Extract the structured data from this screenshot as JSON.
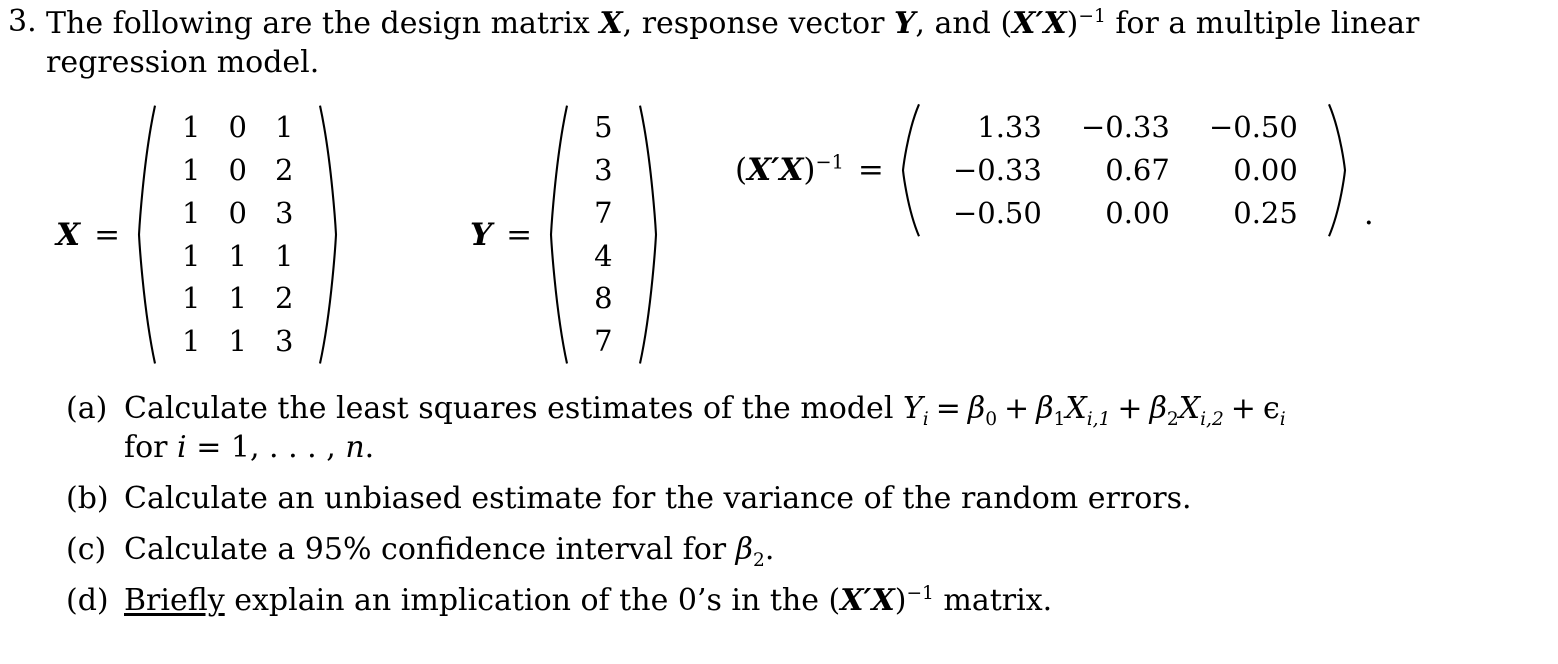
{
  "problem": {
    "number": "3.",
    "intro_part1": "The following are the design matrix ",
    "var_X": "X",
    "intro_part2": ", response vector ",
    "var_Y": "Y",
    "intro_part3": ", and ",
    "xtx_open": "(",
    "xtx_X1": "X",
    "xtx_prime": "′",
    "xtx_X2": "X",
    "xtx_close": ")",
    "xtx_exp": "−1",
    "intro_part4": " for a multiple linear regression model."
  },
  "matrices": {
    "X": {
      "label": "X",
      "equals": "=",
      "rows": [
        [
          "1",
          "0",
          "1"
        ],
        [
          "1",
          "0",
          "2"
        ],
        [
          "1",
          "0",
          "3"
        ],
        [
          "1",
          "1",
          "1"
        ],
        [
          "1",
          "1",
          "2"
        ],
        [
          "1",
          "1",
          "3"
        ]
      ]
    },
    "Y": {
      "label": "Y",
      "equals": "=",
      "rows": [
        [
          "5"
        ],
        [
          "3"
        ],
        [
          "7"
        ],
        [
          "4"
        ],
        [
          "8"
        ],
        [
          "7"
        ]
      ]
    },
    "XtX_inv": {
      "label_open": "(",
      "label_X1": "X",
      "label_prime": "′",
      "label_X2": "X",
      "label_close": ")",
      "label_exp": "−1",
      "equals": "=",
      "rows": [
        [
          "1.33",
          "−0.33",
          "−0.50"
        ],
        [
          "−0.33",
          "0.67",
          "0.00"
        ],
        [
          "−0.50",
          "0.00",
          "0.25"
        ]
      ],
      "trailing_period": "."
    }
  },
  "subparts": [
    {
      "label": "(a)",
      "text_pre": "Calculate the least squares estimates of the model ",
      "eq_Y": "Y",
      "eq_Y_sub": "i",
      "eq_equals": "=",
      "eq_b0": "β",
      "eq_b0_sub": "0",
      "eq_plus1": "+",
      "eq_b1": "β",
      "eq_b1_sub": "1",
      "eq_X1": "X",
      "eq_X1_sub": "i,1",
      "eq_plus2": "+",
      "eq_b2": "β",
      "eq_b2_sub": "2",
      "eq_X2": "X",
      "eq_X2_sub": "i,2",
      "eq_plus3": "+",
      "eq_eps": "ϵ",
      "eq_eps_sub": "i",
      "line2_pre": "for ",
      "line2_i": "i",
      "line2_equals": " = ",
      "line2_rest": "1, . . . , ",
      "line2_n": "n",
      "line2_period": "."
    },
    {
      "label": "(b)",
      "text": "Calculate an unbiased estimate for the variance of the random errors."
    },
    {
      "label": "(c)",
      "text_pre": "Calculate a 95% confidence interval for ",
      "beta": "β",
      "beta_sub": "2",
      "text_post": "."
    },
    {
      "label": "(d)",
      "underlined_word": "Briefly",
      "text_mid": " explain an implication of the 0’s in the ",
      "xtx_open": "(",
      "xtx_X1": "X",
      "xtx_prime": "′",
      "xtx_X2": "X",
      "xtx_close": ")",
      "xtx_exp": "−1",
      "text_post": " matrix."
    }
  ],
  "colors": {
    "background": "#ffffff",
    "text": "#000000"
  }
}
